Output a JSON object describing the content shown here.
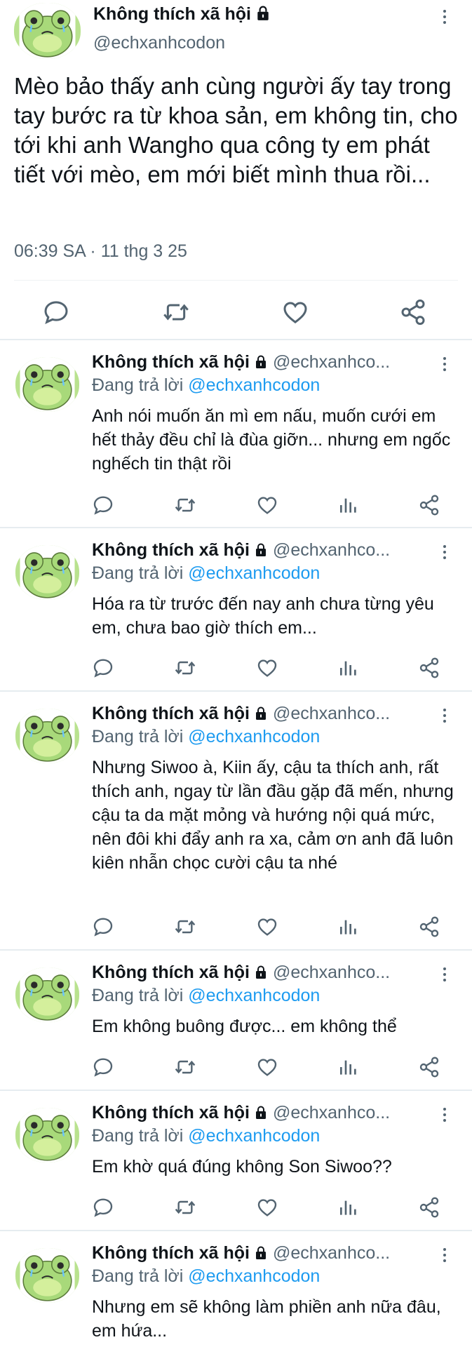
{
  "main_tweet": {
    "display_name": "Không thích xã hội",
    "handle": "@echxanhcodon",
    "text": "Mèo bảo thấy anh cùng người ấy tay trong tay bước ra từ khoa sản, em không tin, cho tới khi anh Wangho qua công ty em phát tiết với mèo, em mới biết mình thua rồi...",
    "timestamp": "06:39 SA · 11 thg 3 25",
    "icons": [
      "reply-icon",
      "retweet-icon",
      "like-icon",
      "share-icon",
      "more-icon",
      "lock-icon"
    ]
  },
  "replies": [
    {
      "display_name": "Không thích xã hội",
      "handle": "@echxanhco...",
      "replying_prefix": "Đang trả lời",
      "replying_to": "@echxanhcodon",
      "text": "Anh nói muốn ăn mì em nấu, muốn cưới em hết thảy đều chỉ là đùa giỡn... nhưng em ngốc nghếch tin thật rồi"
    },
    {
      "display_name": "Không thích xã hội",
      "handle": "@echxanhco...",
      "replying_prefix": "Đang trả lời",
      "replying_to": "@echxanhcodon",
      "text": "Hóa ra từ trước đến nay anh chưa từng yêu em, chưa bao giờ thích em..."
    },
    {
      "display_name": "Không thích xã hội",
      "handle": "@echxanhco...",
      "replying_prefix": "Đang trả lời",
      "replying_to": "@echxanhcodon",
      "text": "Nhưng Siwoo à, Kiin ấy, cậu ta thích anh, rất thích anh, ngay từ lần đầu gặp đã mến, nhưng cậu ta da mặt mỏng và hướng nội quá mức, nên đôi khi đẩy anh ra xa, cảm ơn anh đã luôn kiên nhẫn chọc cười cậu ta nhé"
    },
    {
      "display_name": "Không thích xã hội",
      "handle": "@echxanhco...",
      "replying_prefix": "Đang trả lời",
      "replying_to": "@echxanhcodon",
      "text": "Em không buông được... em không thể"
    },
    {
      "display_name": "Không thích xã hội",
      "handle": "@echxanhco...",
      "replying_prefix": "Đang trả lời",
      "replying_to": "@echxanhcodon",
      "text": "Em khờ quá đúng không Son Siwoo??"
    },
    {
      "display_name": "Không thích xã hội",
      "handle": "@echxanhco...",
      "replying_prefix": "Đang trả lời",
      "replying_to": "@echxanhcodon",
      "text": "Nhưng em sẽ không làm phiền anh nữa đâu, em hứa..."
    }
  ],
  "colors": {
    "link": "#1d9bf0",
    "secondary_text": "#536471",
    "avatar_green": "#b9e28f"
  }
}
